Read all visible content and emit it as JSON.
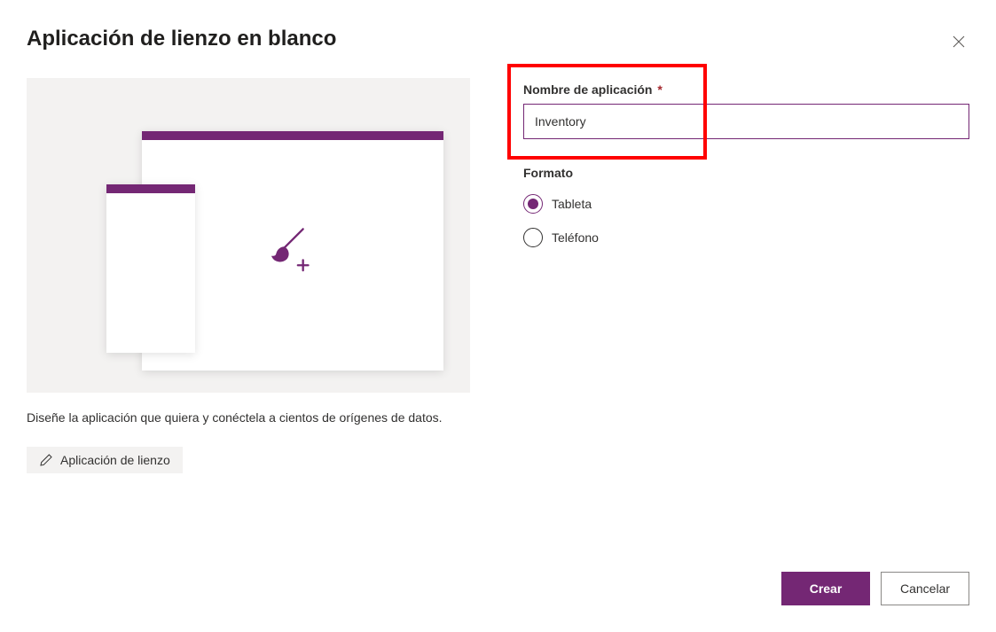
{
  "dialog": {
    "title": "Aplicación de lienzo en blanco",
    "description": "Diseñe la aplicación que quiera y conéctela a cientos de orígenes de datos.",
    "chip_label": "Aplicación de lienzo"
  },
  "form": {
    "app_name_label": "Nombre de aplicación",
    "required_mark": "*",
    "app_name_value": "Inventory",
    "format_label": "Formato",
    "option_tablet": "Tableta",
    "option_phone": "Teléfono"
  },
  "footer": {
    "create_label": "Crear",
    "cancel_label": "Cancelar"
  }
}
